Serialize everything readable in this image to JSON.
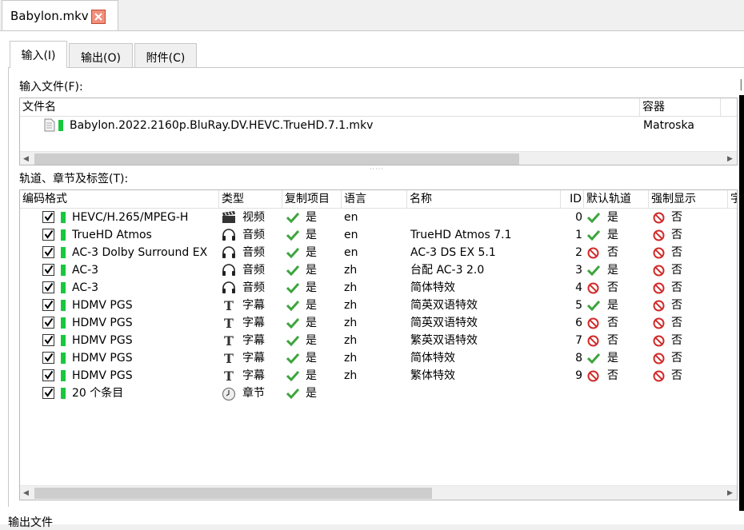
{
  "doc_tab": {
    "title": "Babylon.mkv"
  },
  "subtabs": [
    {
      "label": "输入(I)",
      "active": true
    },
    {
      "label": "输出(O)",
      "active": false
    },
    {
      "label": "附件(C)",
      "active": false
    }
  ],
  "input_files": {
    "label": "输入文件(F):",
    "columns": [
      "文件名",
      "容器"
    ],
    "rows": [
      {
        "name": "Babylon.2022.2160p.BluRay.DV.HEVC.TrueHD.7.1.mkv",
        "container": "Matroska"
      }
    ]
  },
  "tracks": {
    "label": "轨道、章节及标签(T):",
    "columns": [
      "编码格式",
      "类型",
      "复制项目",
      "语言",
      "名称",
      "ID",
      "默认轨道",
      "强制显示",
      "字"
    ],
    "rows": [
      {
        "codec": "HEVC/H.265/MPEG-H",
        "type_icon": "film-clapper-icon",
        "type": "视频",
        "copy": "是",
        "lang": "en",
        "name": "",
        "id": "0",
        "default_icon": "check-icon",
        "default": "是",
        "forced_icon": "no-icon",
        "forced": "否"
      },
      {
        "codec": "TrueHD Atmos",
        "type_icon": "headphones-icon",
        "type": "音频",
        "copy": "是",
        "lang": "en",
        "name": "TrueHD Atmos 7.1",
        "id": "1",
        "default_icon": "check-icon",
        "default": "是",
        "forced_icon": "no-icon",
        "forced": "否"
      },
      {
        "codec": "AC-3 Dolby Surround EX",
        "type_icon": "headphones-icon",
        "type": "音频",
        "copy": "是",
        "lang": "en",
        "name": "AC-3 DS EX 5.1",
        "id": "2",
        "default_icon": "no-icon",
        "default": "否",
        "forced_icon": "no-icon",
        "forced": "否"
      },
      {
        "codec": "AC-3",
        "type_icon": "headphones-icon",
        "type": "音频",
        "copy": "是",
        "lang": "zh",
        "name": "台配 AC-3 2.0",
        "id": "3",
        "default_icon": "check-icon",
        "default": "是",
        "forced_icon": "no-icon",
        "forced": "否"
      },
      {
        "codec": "AC-3",
        "type_icon": "headphones-icon",
        "type": "音频",
        "copy": "是",
        "lang": "zh",
        "name": "简体特效",
        "id": "4",
        "default_icon": "no-icon",
        "default": "否",
        "forced_icon": "no-icon",
        "forced": "否"
      },
      {
        "codec": "HDMV PGS",
        "type_icon": "text-t-icon",
        "type": "字幕",
        "copy": "是",
        "lang": "zh",
        "name": "简英双语特效",
        "id": "5",
        "default_icon": "check-icon",
        "default": "是",
        "forced_icon": "no-icon",
        "forced": "否"
      },
      {
        "codec": "HDMV PGS",
        "type_icon": "text-t-icon",
        "type": "字幕",
        "copy": "是",
        "lang": "zh",
        "name": "简英双语特效",
        "id": "6",
        "default_icon": "no-icon",
        "default": "否",
        "forced_icon": "no-icon",
        "forced": "否"
      },
      {
        "codec": "HDMV PGS",
        "type_icon": "text-t-icon",
        "type": "字幕",
        "copy": "是",
        "lang": "zh",
        "name": "繁英双语特效",
        "id": "7",
        "default_icon": "no-icon",
        "default": "否",
        "forced_icon": "no-icon",
        "forced": "否"
      },
      {
        "codec": "HDMV PGS",
        "type_icon": "text-t-icon",
        "type": "字幕",
        "copy": "是",
        "lang": "zh",
        "name": "简体特效",
        "id": "8",
        "default_icon": "check-icon",
        "default": "是",
        "forced_icon": "no-icon",
        "forced": "否"
      },
      {
        "codec": "HDMV PGS",
        "type_icon": "text-t-icon",
        "type": "字幕",
        "copy": "是",
        "lang": "zh",
        "name": "繁体特效",
        "id": "9",
        "default_icon": "no-icon",
        "default": "否",
        "forced_icon": "no-icon",
        "forced": "否"
      },
      {
        "codec": "20 个条目",
        "type_icon": "clock-icon",
        "type": "章节",
        "copy": "是",
        "lang": "",
        "name": "",
        "id": "",
        "default_icon": "",
        "default": "",
        "forced_icon": "",
        "forced": ""
      }
    ]
  },
  "bottom_label": "输出文件",
  "colors": {
    "track_green": "#17c83c",
    "check_green": "#3da53d",
    "no_red": "#d12b2b"
  }
}
